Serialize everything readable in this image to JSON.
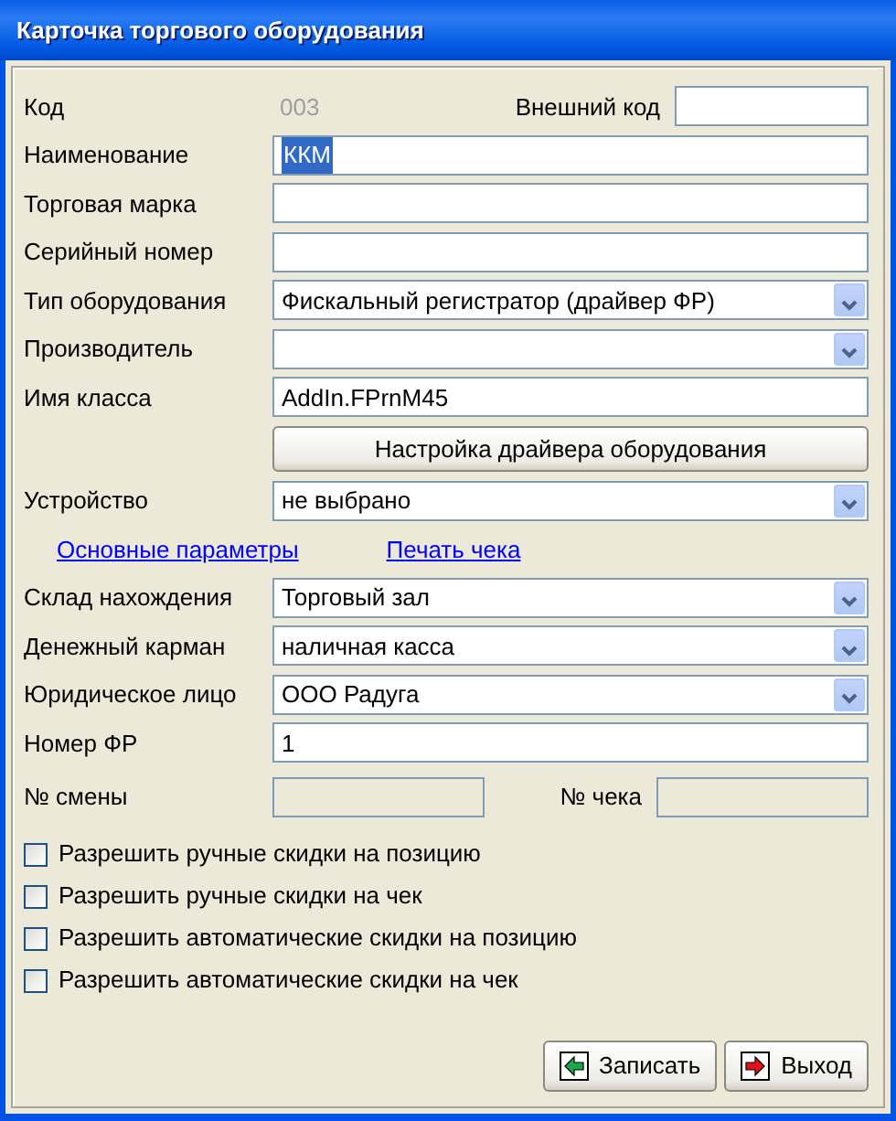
{
  "window": {
    "title": "Карточка торгового оборудования"
  },
  "rows": [
    {
      "kind": "code",
      "label": "Код",
      "value": "003",
      "side_label": "Внешний код"
    },
    {
      "kind": "text",
      "label": "Наименование",
      "value": "ККМ",
      "highlighted": true
    },
    {
      "kind": "text",
      "label": "Торговая марка"
    },
    {
      "kind": "text",
      "label": "Серийный номер"
    },
    {
      "kind": "select",
      "label": "Тип оборудования",
      "value": "Фискальный регистратор (драйвер ФР)"
    },
    {
      "kind": "select",
      "label": "Производитель"
    },
    {
      "kind": "text",
      "label": "Имя класса",
      "value": "AddIn.FPrnM45",
      "highlighted": false
    },
    {
      "kind": "button",
      "label": "Настройка драйвера оборудования"
    },
    {
      "kind": "select",
      "label": "Устройство",
      "value": "не выбрано"
    },
    {
      "kind": "links",
      "links": [
        "Основные параметры",
        "Печать чека"
      ]
    },
    {
      "kind": "select",
      "label": "Склад нахождения",
      "value": "Торговый зал"
    },
    {
      "kind": "select",
      "label": "Денежный карман",
      "value": "наличная касса"
    },
    {
      "kind": "select",
      "label": "Юридическое лицо",
      "value": "ООО Радуга"
    },
    {
      "kind": "text",
      "label": "Номер ФР",
      "value": "1",
      "highlighted": false
    },
    {
      "kind": "counters",
      "label": "№ смены",
      "side_label": "№ чека"
    }
  ],
  "checkboxes": [
    {
      "label": "Разрешить ручные скидки на позицию",
      "checked": false
    },
    {
      "label": "Разрешить ручные скидки на чек",
      "checked": false
    },
    {
      "label": "Разрешить автоматические скидки на позицию",
      "checked": false
    },
    {
      "label": "Разрешить автоматические скидки на чек",
      "checked": false
    }
  ],
  "buttons": [
    {
      "kind": "save",
      "label": "Записать"
    },
    {
      "kind": "exit",
      "label": "Выход"
    }
  ]
}
